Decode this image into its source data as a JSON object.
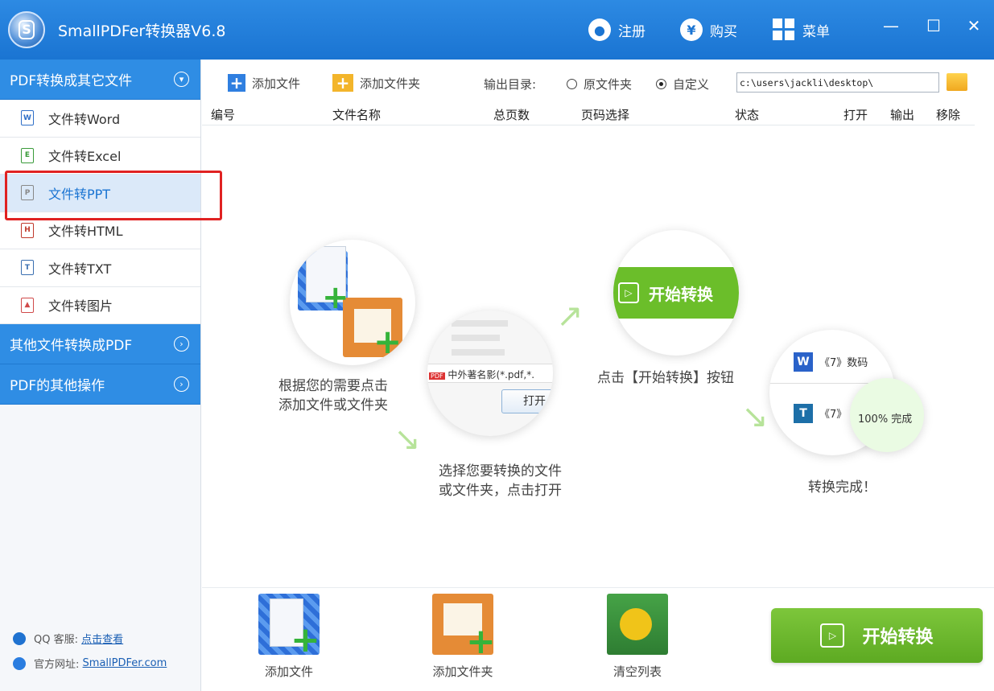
{
  "app": {
    "title": "SmallPDFer转换器V6.8",
    "logo_letter": "S"
  },
  "titlebar": {
    "register": "注册",
    "buy": "购买",
    "buy_symbol": "¥",
    "menu": "菜单",
    "minimize": "—",
    "maximize": "☐",
    "close": "✕"
  },
  "sidebar": {
    "section1": "PDF转换成其它文件",
    "items": [
      {
        "label": "文件转Word",
        "icon": "word-doc-icon",
        "glyph": "W"
      },
      {
        "label": "文件转Excel",
        "icon": "excel-doc-icon",
        "glyph": "E"
      },
      {
        "label": "文件转PPT",
        "icon": "ppt-doc-icon",
        "glyph": "P"
      },
      {
        "label": "文件转HTML",
        "icon": "html-doc-icon",
        "glyph": "H"
      },
      {
        "label": "文件转TXT",
        "icon": "txt-doc-icon",
        "glyph": "T"
      },
      {
        "label": "文件转图片",
        "icon": "image-doc-icon",
        "glyph": "▲"
      }
    ],
    "active_item": "文件转PPT",
    "section2": "其他文件转换成PDF",
    "section3": "PDF的其他操作",
    "qq_label": "QQ 客服:",
    "qq_link": "点击查看",
    "site_label": "官方网址:",
    "site_link": "SmallPDFer.com"
  },
  "toolbar": {
    "add_file": "添加文件",
    "add_folder": "添加文件夹",
    "output_label": "输出目录:",
    "radio_original": "原文件夹",
    "radio_custom": "自定义",
    "selected_output": "自定义",
    "output_path": "c:\\users\\jackli\\desktop\\"
  },
  "table": {
    "headers": [
      "编号",
      "文件名称",
      "总页数",
      "页码选择",
      "状态",
      "打开",
      "输出",
      "移除"
    ]
  },
  "illustration": {
    "step1": "根据您的需要点击\n添加文件或文件夹",
    "step2": "选择您要转换的文件\n或文件夹，点击打开",
    "step3": "点击【开始转换】按钮",
    "step4": "转换完成！",
    "start_label": "开始转换",
    "dialog_file": "中外著名影",
    "dialog_ext": "(*.pdf,*.",
    "dialog_open": "打开",
    "pdf_badge": "PDF",
    "result_row1": "《7》数码",
    "result_row2": "《7》",
    "progress_text": "100% 完成"
  },
  "bottom": {
    "add_file": "添加文件",
    "add_folder": "添加文件夹",
    "clear_list": "清空列表",
    "start": "开始转换"
  },
  "colors": {
    "title_blue": "#1a74d2",
    "accent_green": "#6bbe2a",
    "highlight_red": "#e02222"
  }
}
